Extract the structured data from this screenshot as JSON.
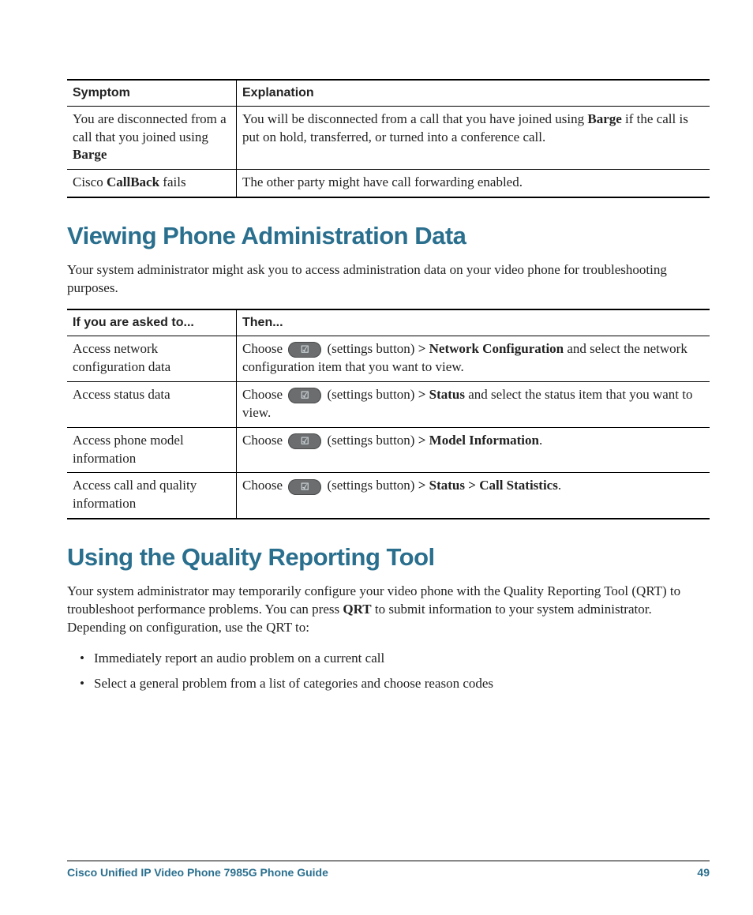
{
  "table1": {
    "head": {
      "col1": "Symptom",
      "col2": "Explanation"
    },
    "rows": [
      {
        "col1_pre": "You are disconnected from a call that you joined using ",
        "col1_bold": "Barge",
        "col2_pre": "You will be disconnected from a call that you have joined using ",
        "col2_bold": "Barge",
        "col2_post": " if the call is put on hold, transferred, or turned into a conference call."
      },
      {
        "col1_pre": "Cisco ",
        "col1_bold": "CallBack",
        "col1_post": " fails",
        "col2": "The other party might have call forwarding enabled."
      }
    ]
  },
  "section1": {
    "title": "Viewing Phone Administration Data",
    "intro": "Your system administrator might ask you to access administration data on your video phone for troubleshooting purposes."
  },
  "table2": {
    "head": {
      "col1": "If you are asked to...",
      "col2": "Then..."
    },
    "rows": [
      {
        "col1": "Access network configuration data",
        "choose": "Choose",
        "btn_label": "(settings button)",
        "path_pre": " > ",
        "path_bold": "Network Configuration",
        "path_post": " and select the network configuration item that you want to view."
      },
      {
        "col1": "Access status data",
        "choose": "Choose",
        "btn_label": "(settings button)",
        "path_pre": " > ",
        "path_bold": "Status",
        "path_post": " and select the status item that you want to view."
      },
      {
        "col1": "Access phone model information",
        "choose": "Choose",
        "btn_label": "(settings button)",
        "path_pre": " > ",
        "path_bold": "Model Information",
        "path_post": "."
      },
      {
        "col1": "Access call and quality information",
        "choose": "Choose",
        "btn_label": "(settings button)",
        "path_pre": " > ",
        "path_bold": "Status > Call Statistics",
        "path_post": "."
      }
    ]
  },
  "section2": {
    "title": "Using the Quality Reporting Tool",
    "intro_pre": "Your system administrator may temporarily configure your video phone with the Quality Reporting Tool (QRT) to troubleshoot performance problems. You can press ",
    "intro_bold": "QRT",
    "intro_post": " to submit information to your system administrator. Depending on configuration, use the QRT to:",
    "bullets": [
      "Immediately report an audio problem on a current call",
      "Select a general problem from a list of categories and choose reason codes"
    ]
  },
  "footer": {
    "left": "Cisco Unified IP Video Phone 7985G Phone Guide",
    "right": "49"
  }
}
